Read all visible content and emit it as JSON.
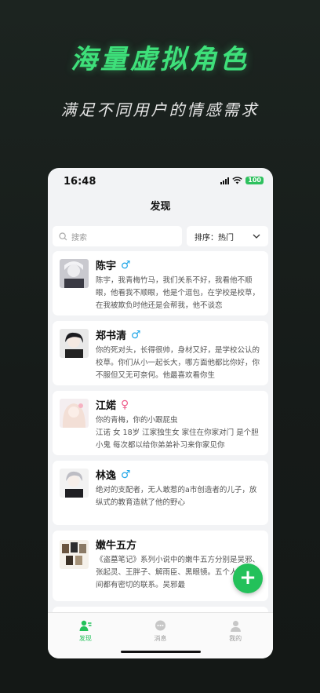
{
  "promo": {
    "headline": "海量虚拟角色",
    "subline": "满足不同用户的情感需求"
  },
  "status_bar": {
    "time": "16:48",
    "battery": "100"
  },
  "screen": {
    "title": "发现"
  },
  "search": {
    "placeholder": "搜索"
  },
  "sort": {
    "label": "排序：热门"
  },
  "characters": [
    {
      "name": "陈宇",
      "gender": "♂",
      "desc": "陈宇，我青梅竹马，我们关系不好，我看他不顺眼，他看我不顺眼，他是个逗包，在学校是校草，在我被欺负时他还是会帮我，他不谈恋"
    },
    {
      "name": "郑书清",
      "gender": "♂",
      "desc": "你的死对头，长得很帅，身材又好，是学校公认的校草。你们从小一起长大，哪方面他都比你好，你不服但又无可奈何。他最喜欢看你生"
    },
    {
      "name": "江婼",
      "gender": "♀",
      "desc": "你的青梅，你的小跟屁虫\n江诺 女 18岁 江家独生女 家住在你家对门 是个胆小鬼 每次都以给你弟弟补习来你家见你"
    },
    {
      "name": "林逸",
      "gender": "♂",
      "desc": "绝对的支配者，无人敢惹的a市创造者的儿子，放纵式的教育造就了他的野心"
    },
    {
      "name": "嫩牛五方",
      "gender": "",
      "desc": "《盗墓笔记》系列小说中的嫩牛五方分别是吴邪、张起灵、王胖子、解雨臣、黑眼镜。五个人相互之间都有密切的联系。吴邪最"
    }
  ],
  "tabs": [
    {
      "label": "发现",
      "icon": "discover-icon"
    },
    {
      "label": "消息",
      "icon": "message-icon"
    },
    {
      "label": "我的",
      "icon": "profile-icon"
    }
  ],
  "colors": {
    "accent": "#23c15a",
    "male": "#22a7e8",
    "female": "#ef5d8c",
    "headline": "#3ee07a"
  }
}
